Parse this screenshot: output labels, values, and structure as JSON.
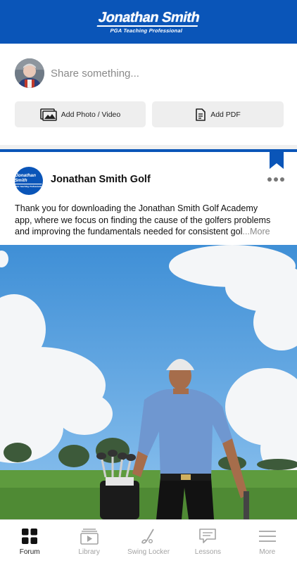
{
  "header": {
    "logo_main": "Jonathan Smith",
    "logo_sub": "PGA Teaching Professional"
  },
  "composer": {
    "placeholder": "Share something...",
    "add_photo_label": "Add Photo / Video",
    "add_pdf_label": "Add PDF"
  },
  "post": {
    "avatar_main": "Jonathan Smith",
    "avatar_sub": "PGA Teaching Professional",
    "author": "Jonathan Smith Golf",
    "text_lines": [
      "Thank you for downloading the Jonathan Smith Golf Academy",
      "app, where we focus on finding the cause of the golfers problems",
      "and improving the fundamentals needed for consistent gol"
    ],
    "more_label": "...More"
  },
  "tabs": [
    {
      "label": "Forum",
      "icon": "grid-icon",
      "active": true
    },
    {
      "label": "Library",
      "icon": "video-library-icon",
      "active": false
    },
    {
      "label": "Swing Locker",
      "icon": "golf-club-icon",
      "active": false
    },
    {
      "label": "Lessons",
      "icon": "chat-bubble-icon",
      "active": false
    },
    {
      "label": "More",
      "icon": "menu-icon",
      "active": false
    }
  ],
  "colors": {
    "brand_blue": "#0a55b8",
    "button_gray": "#eeeeee",
    "inactive_tab": "#a3a3a3"
  }
}
